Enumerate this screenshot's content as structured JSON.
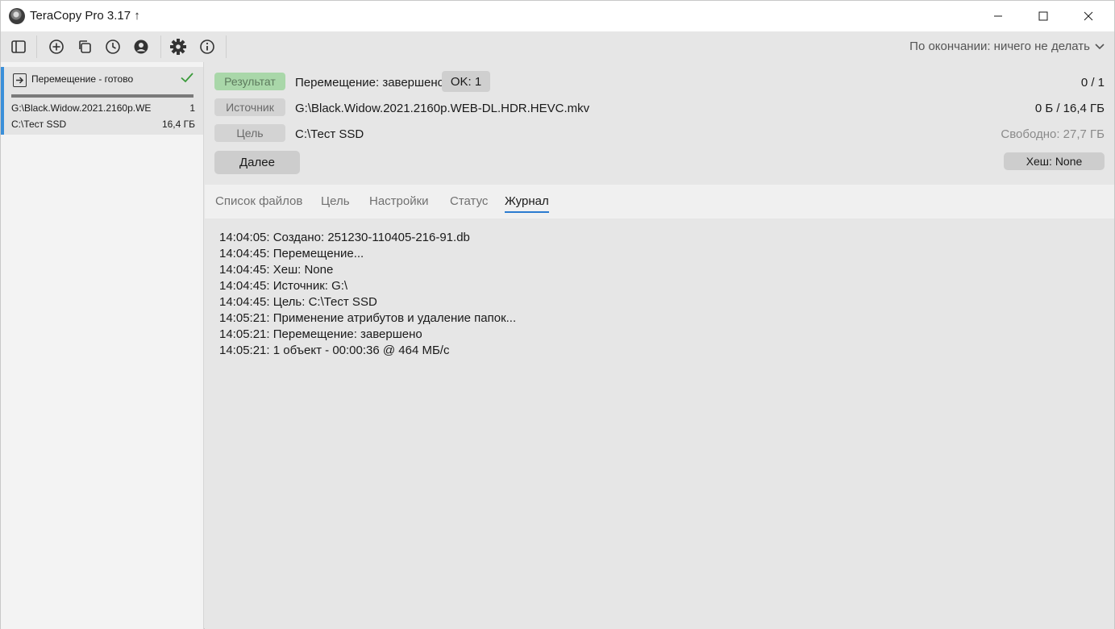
{
  "window": {
    "title": "TeraCopy Pro 3.17 ↑"
  },
  "toolbar": {
    "icons": [
      "sidebar-toggle-icon",
      "add-icon",
      "copy-icon",
      "history-icon",
      "account-icon",
      "settings-icon",
      "info-icon"
    ],
    "on_finish": "По окончании: ничего не делать"
  },
  "sidebar": {
    "job": {
      "title": "Перемещение - готово",
      "progress": 1.0,
      "source": "G:\\Black.Widow.2021.2160p.WE",
      "source_count": "1",
      "target": "C:\\Тест SSD",
      "target_size": "16,4 ГБ"
    }
  },
  "main": {
    "result_label": "Результат",
    "result_value": "Перемещение: завершено",
    "ok_badge": "OK: 1",
    "count": "0 / 1",
    "source_label": "Источник",
    "source_value": "G:\\Black.Widow.2021.2160p.WEB-DL.HDR.HEVC.mkv",
    "size": "0 Б / 16,4 ГБ",
    "target_label": "Цель",
    "target_value": "C:\\Тест SSD",
    "free": "Свободно: 27,7 ГБ",
    "next_button": "Далее",
    "hash_button": "Хеш: None"
  },
  "tabs": [
    "Список файлов",
    "Цель",
    "Настройки",
    "Статус",
    "Журнал"
  ],
  "active_tab": "Журнал",
  "log": [
    "14:04:05: Создано: 251230-110405-216-91.db",
    "14:04:45: Перемещение...",
    "14:04:45: Хеш: None",
    "14:04:45: Источник: G:\\",
    "14:04:45: Цель: C:\\Тест SSD",
    "14:05:21: Применение атрибутов и удаление папок...",
    "14:05:21: Перемещение: завершено",
    "14:05:21: 1 объект - 00:00:36 @ 464 МБ/с"
  ],
  "colors": {
    "accent": "#2b7bd0",
    "result_tag": "#a9d7a9",
    "check": "#3a9a3a"
  }
}
